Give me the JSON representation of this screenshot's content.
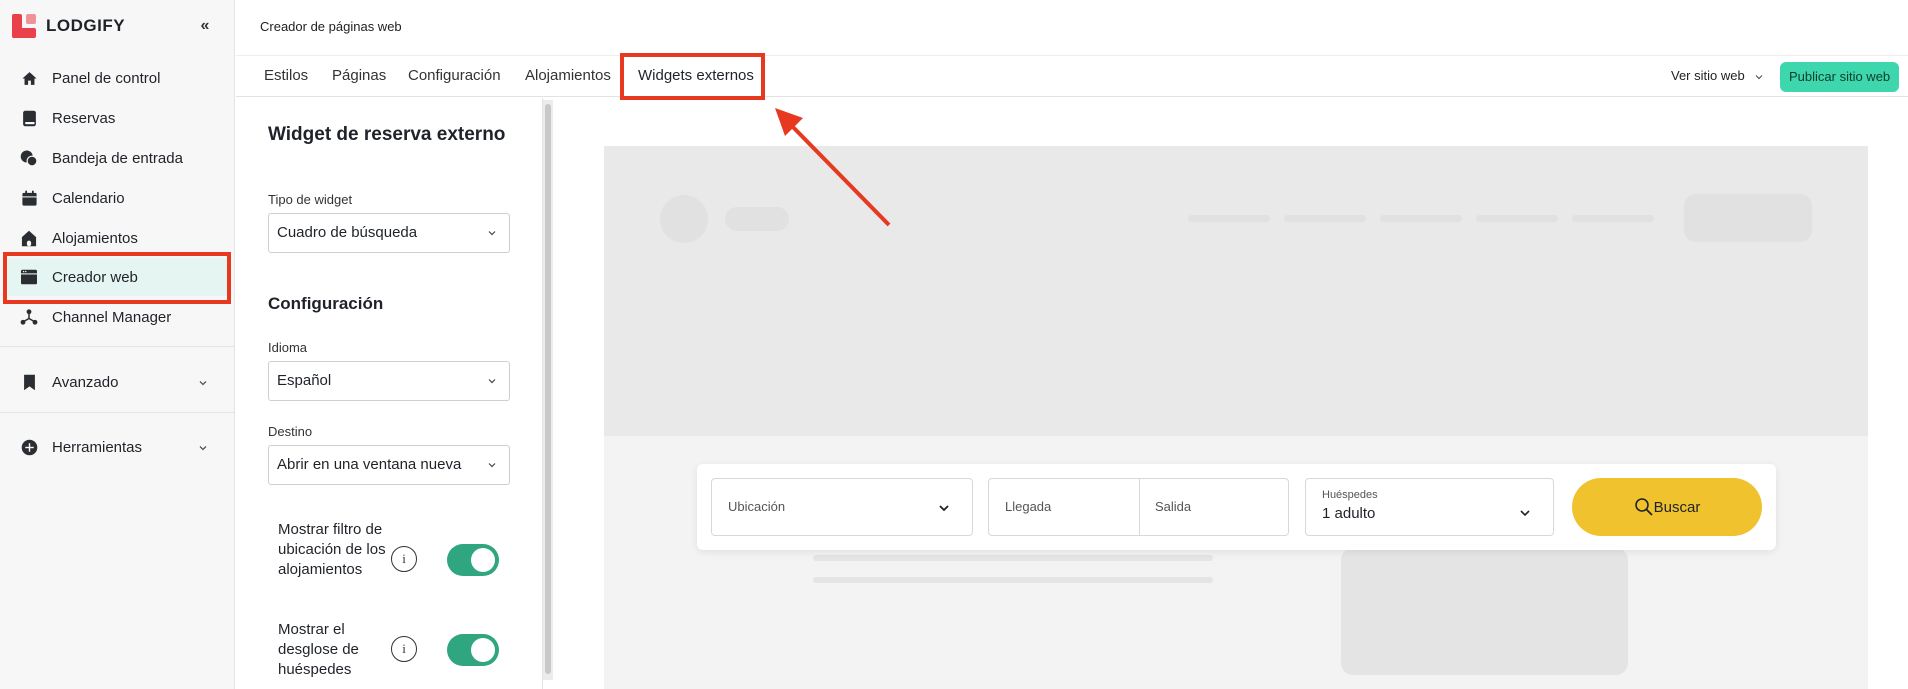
{
  "app": {
    "logo_text": "LODGIFY",
    "collapse_glyph": "«"
  },
  "sidebar": {
    "items": [
      {
        "label": "Panel de control",
        "icon": "home-icon"
      },
      {
        "label": "Reservas",
        "icon": "book-icon"
      },
      {
        "label": "Bandeja de entrada",
        "icon": "chat-icon"
      },
      {
        "label": "Calendario",
        "icon": "calendar-icon"
      },
      {
        "label": "Alojamientos",
        "icon": "house-icon"
      },
      {
        "label": "Creador web",
        "icon": "browser-icon",
        "active": true
      },
      {
        "label": "Channel Manager",
        "icon": "network-icon"
      },
      {
        "label": "Avanzado",
        "icon": "bookmark-icon",
        "expandable": true
      },
      {
        "label": "Herramientas",
        "icon": "plus-circle-icon",
        "expandable": true
      }
    ]
  },
  "header": {
    "title": "Creador de páginas web",
    "view_site": "Ver sitio web",
    "publish": "Publicar sitio web"
  },
  "tabs": [
    {
      "label": "Estilos"
    },
    {
      "label": "Páginas"
    },
    {
      "label": "Configuración"
    },
    {
      "label": "Alojamientos"
    },
    {
      "label": "Widgets externos",
      "active": true
    }
  ],
  "panel": {
    "title": "Widget de reserva externo",
    "widget_type_label": "Tipo de widget",
    "widget_type_value": "Cuadro de búsqueda",
    "config_heading": "Configuración",
    "language_label": "Idioma",
    "language_value": "Español",
    "target_label": "Destino",
    "target_value": "Abrir en una ventana nueva",
    "toggles": [
      {
        "label": "Mostrar filtro de ubicación de los alojamientos",
        "on": true
      },
      {
        "label": "Mostrar el desglose de huéspedes",
        "on": true
      }
    ],
    "info_glyph": "i"
  },
  "preview": {
    "location_label": "Ubicación",
    "arrival_label": "Llegada",
    "departure_label": "Salida",
    "guests_label": "Huéspedes",
    "guests_value": "1 adulto",
    "search_button": "Buscar"
  },
  "colors": {
    "accent_green": "#3dd6ad",
    "toggle_green": "#2fa67f",
    "highlight_red": "#e6391f",
    "search_yellow": "#f0c22e",
    "brand_red": "#e8414b"
  }
}
